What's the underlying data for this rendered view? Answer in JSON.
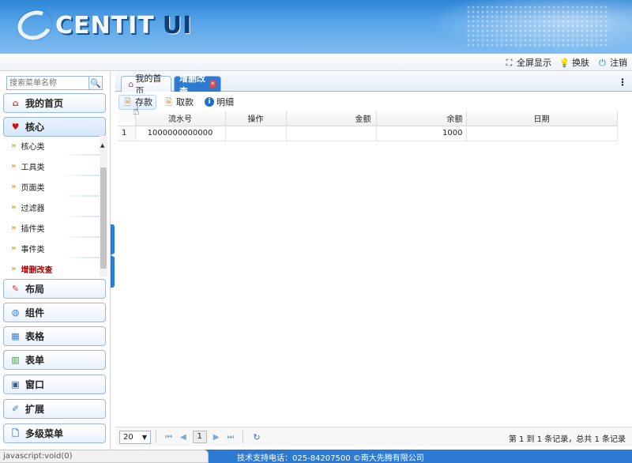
{
  "header": {
    "logo_text": "CENTIT",
    "logo_suffix": "UI",
    "colors": {
      "primary": "#2d7ad2",
      "accent_tab": "#2d7ad2",
      "active_menu": "#b00000"
    }
  },
  "topbar": {
    "fullscreen": "全屏显示",
    "skin": "换肤",
    "logout": "注销"
  },
  "sidebar": {
    "search_placeholder": "搜索菜单名称",
    "menu": [
      {
        "label": "我的首页",
        "icon": "home-icon"
      },
      {
        "label": "核心",
        "icon": "heart-icon"
      },
      {
        "label": "布局",
        "icon": "pencil-icon"
      },
      {
        "label": "组件",
        "icon": "globe-icon"
      },
      {
        "label": "表格",
        "icon": "table-icon"
      },
      {
        "label": "表单",
        "icon": "chart-icon"
      },
      {
        "label": "窗口",
        "icon": "window-icon"
      },
      {
        "label": "扩展",
        "icon": "edit-icon"
      },
      {
        "label": "多级菜单",
        "icon": "document-icon"
      }
    ],
    "submenu": [
      "核心类",
      "工具类",
      "页面类",
      "过滤器",
      "插件类",
      "事件类",
      "增删改查"
    ]
  },
  "tabs": [
    {
      "label": "我的首页"
    },
    {
      "label": "增删改查"
    }
  ],
  "toolbar": {
    "deposit": "存款",
    "withdraw": "取款",
    "detail": "明细"
  },
  "grid": {
    "columns": [
      "流水号",
      "操作",
      "金额",
      "余额",
      "日期"
    ],
    "rows": [
      {
        "rownum": "1",
        "serial": "1000000000000",
        "op": "",
        "amount": "",
        "balance": "1000",
        "date": ""
      }
    ]
  },
  "pager": {
    "page_size": "20",
    "page": "1",
    "info": "第 1 到 1 条记录，总共 1 条记录"
  },
  "footer": {
    "support": "技术支持电话：025-84207500 ©南大先腾有限公司",
    "status": "javascript:void(0)"
  }
}
